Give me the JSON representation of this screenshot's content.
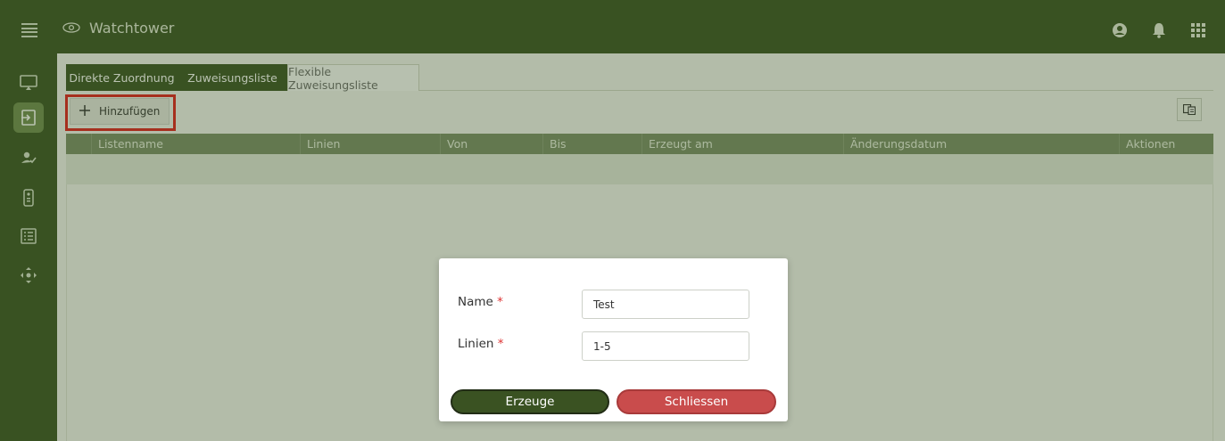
{
  "app": {
    "title": "Watchtower"
  },
  "tabs": [
    {
      "label": "Direkte Zuordnung"
    },
    {
      "label": "Zuweisungsliste"
    },
    {
      "label": "Flexible Zuweisungsliste"
    }
  ],
  "toolbar": {
    "add_label": "Hinzufügen"
  },
  "table": {
    "columns": [
      "Listenname",
      "Linien",
      "Von",
      "Bis",
      "Erzeugt am",
      "Änderungsdatum",
      "Aktionen"
    ]
  },
  "dialog": {
    "name_label": "Name",
    "name_value": "Test",
    "lines_label": "Linien",
    "lines_value": "1-5",
    "required_marker": "*",
    "create_label": "Erzeuge",
    "close_label": "Schliessen"
  },
  "colors": {
    "primary": "#3a5222",
    "danger": "#c94c4c",
    "highlight": "#e01c1c"
  },
  "icons": {
    "menu": "hamburger-icon",
    "brand": "eye-icon",
    "account": "account-circle-icon",
    "notifications": "bell-icon",
    "apps": "grid-icon",
    "sidebar": [
      "monitor-icon",
      "login-icon",
      "person-check-icon",
      "remote-icon",
      "list-icon",
      "move-icon"
    ],
    "add": "plus-icon",
    "layout": "layout-icon"
  }
}
